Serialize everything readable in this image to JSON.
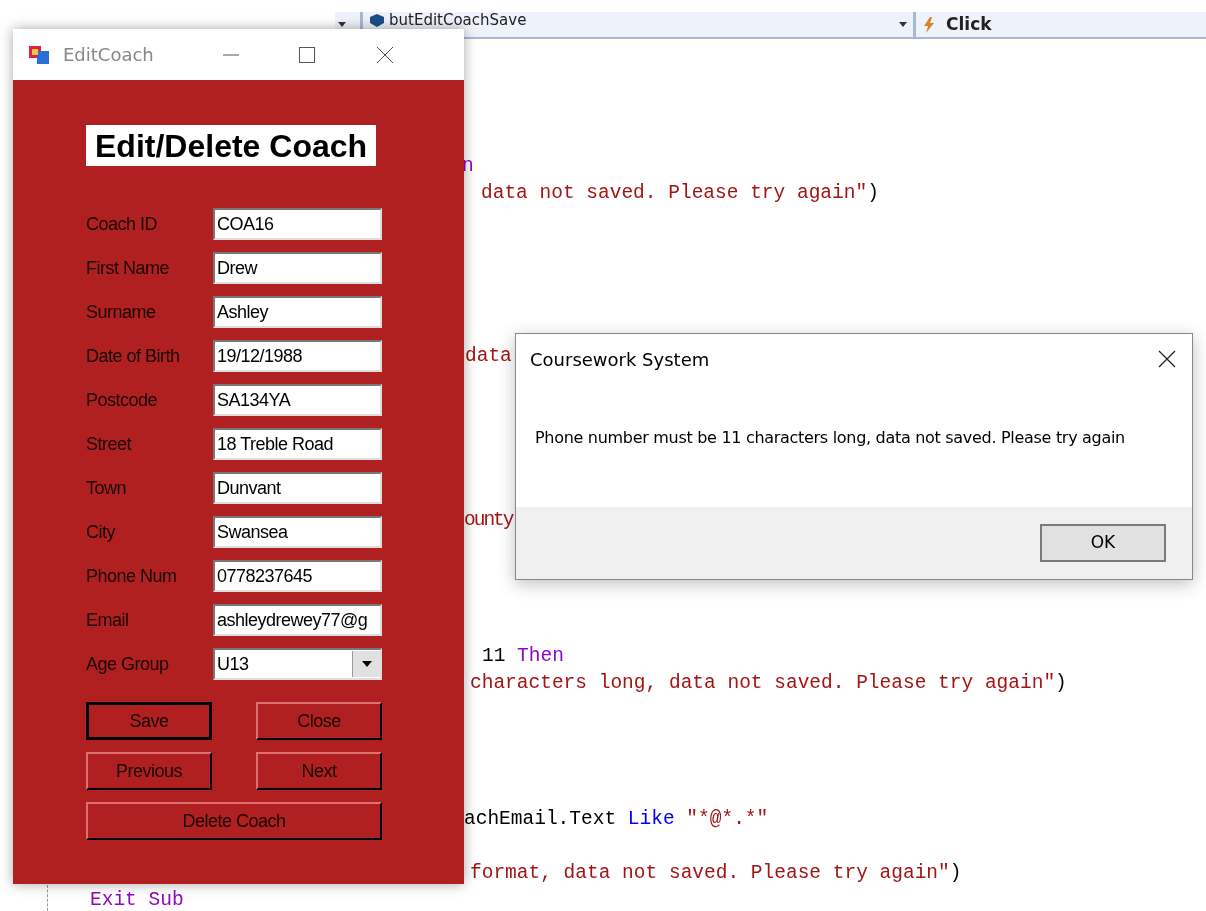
{
  "editor": {
    "nav_bar": {
      "member": "butEditCoachSave",
      "event": "Click"
    },
    "code_lines": [
      {
        "segments": [
          {
            "text": "n",
            "kind": "keyword"
          }
        ]
      },
      {
        "segments": [
          {
            "text": "data not saved. Please try again\"",
            "kind": "string"
          },
          {
            "text": ")",
            "kind": "plain"
          }
        ]
      },
      {
        "segments": [
          {
            "text": "data",
            "kind": "string"
          }
        ]
      },
      {
        "segments": [
          {
            "text": "ounty",
            "kind": "string"
          }
        ]
      },
      {
        "segments": [
          {
            "text": "11 ",
            "kind": "plain"
          },
          {
            "text": "Then",
            "kind": "keyword"
          }
        ]
      },
      {
        "segments": [
          {
            "text": "characters long, data not saved. Please try again\"",
            "kind": "string"
          },
          {
            "text": ")",
            "kind": "plain"
          }
        ]
      },
      {
        "segments": [
          {
            "text": "achEmail.Text ",
            "kind": "plain"
          },
          {
            "text": "Like",
            "kind": "operator"
          },
          {
            "text": " \"*@*.*\"",
            "kind": "string"
          }
        ]
      },
      {
        "segments": [
          {
            "text": "format, data not saved. Please try again\"",
            "kind": "string"
          },
          {
            "text": ")",
            "kind": "plain"
          }
        ]
      },
      {
        "segments": [
          {
            "text": "Exit Sub",
            "kind": "keyword"
          }
        ]
      }
    ]
  },
  "form_window": {
    "title": "EditCoach",
    "heading": "Edit/Delete Coach",
    "fields": [
      {
        "label": "Coach ID",
        "value": "COA16",
        "kind": "text"
      },
      {
        "label": "First Name",
        "value": "Drew",
        "kind": "text"
      },
      {
        "label": "Surname",
        "value": "Ashley",
        "kind": "text"
      },
      {
        "label": "Date of Birth",
        "value": "19/12/1988",
        "kind": "text"
      },
      {
        "label": "Postcode",
        "value": "SA134YA",
        "kind": "text"
      },
      {
        "label": "Street",
        "value": "18 Treble Road",
        "kind": "text"
      },
      {
        "label": "Town",
        "value": "Dunvant",
        "kind": "text"
      },
      {
        "label": "City",
        "value": "Swansea",
        "kind": "text"
      },
      {
        "label": "Phone Num",
        "value": "0778237645",
        "kind": "text"
      },
      {
        "label": "Email",
        "value": "ashleydrewey77@g",
        "kind": "text"
      },
      {
        "label": "Age Group",
        "value": "U13",
        "kind": "dropdown"
      }
    ],
    "buttons": [
      {
        "label": "Save",
        "default": true
      },
      {
        "label": "Close",
        "default": false
      },
      {
        "label": "Previous",
        "default": false
      },
      {
        "label": "Next",
        "default": false
      },
      {
        "label": "Delete Coach",
        "default": false
      }
    ]
  },
  "message_box": {
    "title": "Coursework System",
    "message": "Phone number must be 11 characters long, data not saved. Please try again",
    "buttons": [
      "OK"
    ]
  }
}
